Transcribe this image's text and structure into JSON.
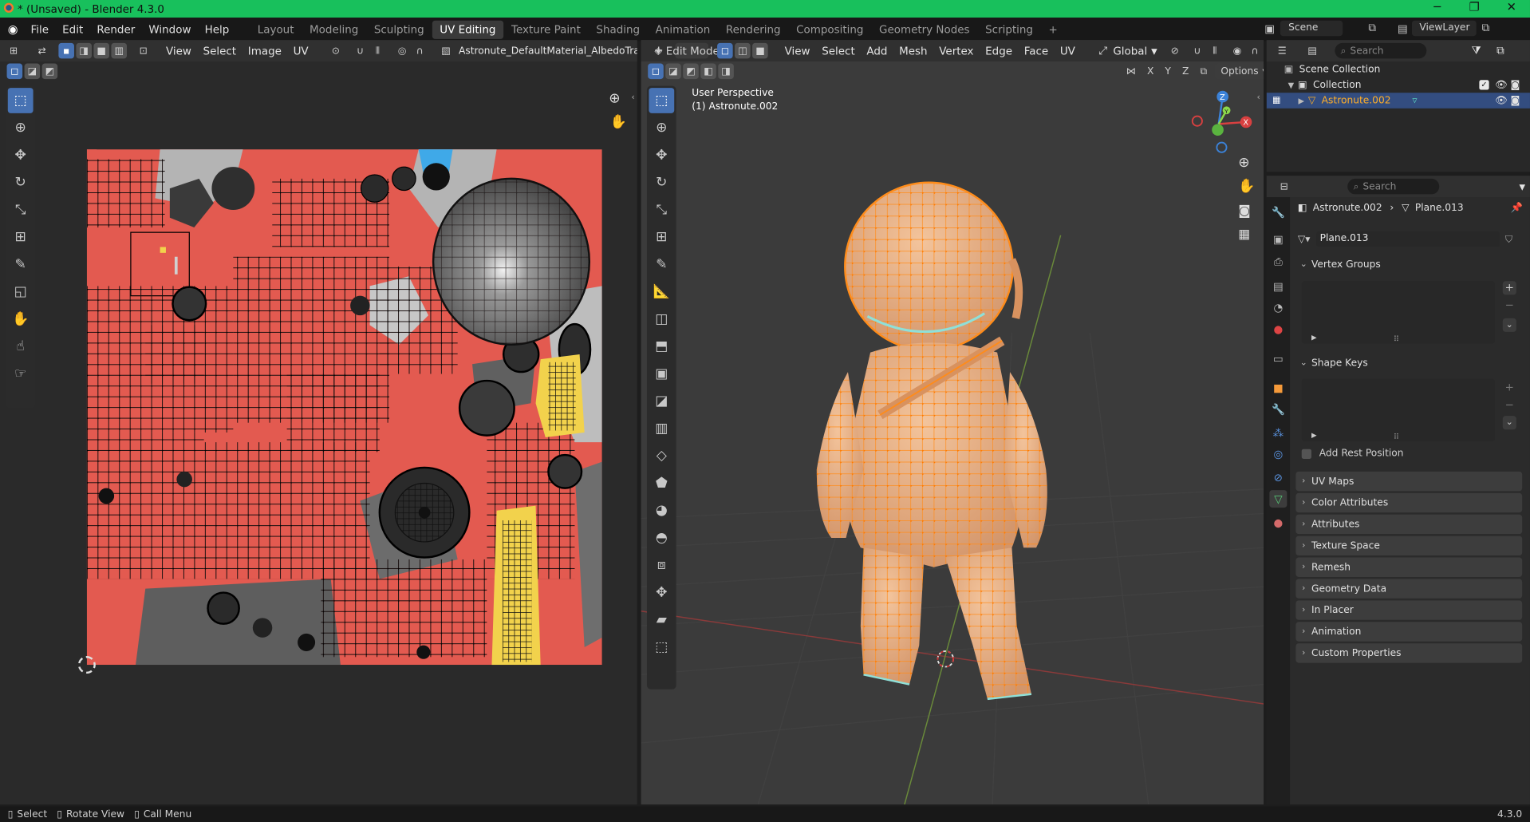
{
  "window": {
    "title": "* (Unsaved) - Blender 4.3.0",
    "controls": [
      "─",
      "❐",
      "✕"
    ]
  },
  "menu": [
    "File",
    "Edit",
    "Render",
    "Window",
    "Help"
  ],
  "workspaces": [
    {
      "label": "Layout",
      "active": false
    },
    {
      "label": "Modeling",
      "active": false
    },
    {
      "label": "Sculpting",
      "active": false
    },
    {
      "label": "UV Editing",
      "active": true
    },
    {
      "label": "Texture Paint",
      "active": false
    },
    {
      "label": "Shading",
      "active": false
    },
    {
      "label": "Animation",
      "active": false
    },
    {
      "label": "Rendering",
      "active": false
    },
    {
      "label": "Compositing",
      "active": false
    },
    {
      "label": "Geometry Nodes",
      "active": false
    },
    {
      "label": "Scripting",
      "active": false
    }
  ],
  "add_workspace": "+",
  "scene": {
    "label": "Scene",
    "view_layer": "ViewLayer"
  },
  "uv_editor": {
    "menus": [
      "View",
      "Select",
      "Image",
      "UV"
    ],
    "image_name": "Astronute_DefaultMaterial_AlbedoTranspare"
  },
  "viewport": {
    "mode": "Edit Mode",
    "menus": [
      "View",
      "Select",
      "Add",
      "Mesh",
      "Vertex",
      "Edge",
      "Face",
      "UV"
    ],
    "transform_orientation": "Global",
    "axes": [
      "X",
      "Y",
      "Z"
    ],
    "options": "Options",
    "perspective": "User Perspective",
    "object_label": "(1) Astronute.002"
  },
  "outliner": {
    "search_placeholder": "Search",
    "scene_collection": "Scene Collection",
    "collection": "Collection",
    "object": "Astronute.002"
  },
  "properties": {
    "search_placeholder": "Search",
    "object_name": "Astronute.002",
    "mesh_name": "Plane.013",
    "data_name": "Plane.013",
    "panels": {
      "vertex_groups": "Vertex Groups",
      "shape_keys": "Shape Keys",
      "add_rest_position": "Add Rest Position",
      "uv_maps": "UV Maps",
      "color_attributes": "Color Attributes",
      "attributes": "Attributes",
      "texture_space": "Texture Space",
      "remesh": "Remesh",
      "geometry_data": "Geometry Data",
      "in_placer": "In Placer",
      "animation": "Animation",
      "custom_properties": "Custom Properties"
    }
  },
  "status": {
    "select": "Select",
    "rotate": "Rotate View",
    "call_menu": "Call Menu",
    "version": "4.3.0"
  },
  "colors": {
    "accent": "#4772b3",
    "selection": "#ff8c1a",
    "titlebar": "#18c05c",
    "active_object": "#ffaf29"
  }
}
